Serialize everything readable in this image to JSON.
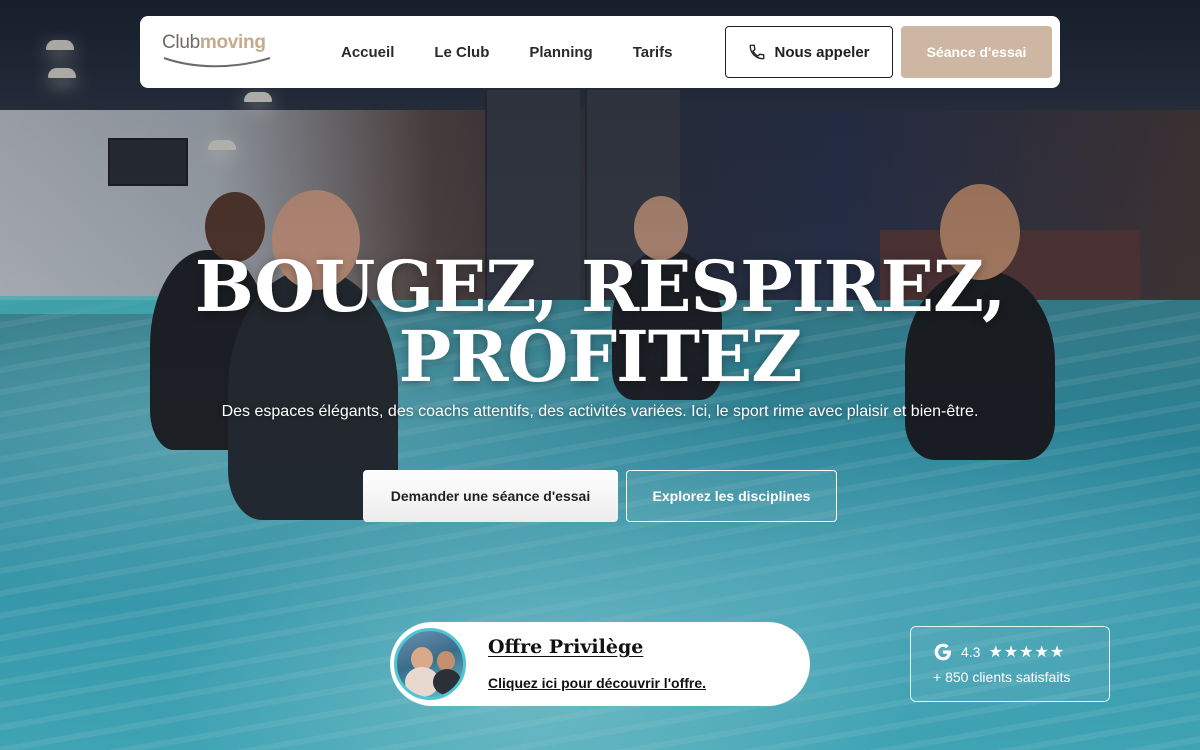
{
  "brand": {
    "logo_part1": "Club",
    "logo_part2": "moving",
    "accent_color": "#cdb7a2",
    "logo_accent_color": "#c5aa8c"
  },
  "nav": {
    "items": [
      {
        "label": "Accueil"
      },
      {
        "label": "Le Club"
      },
      {
        "label": "Planning"
      },
      {
        "label": "Tarifs"
      }
    ],
    "call_label": "Nous appeler",
    "call_icon": "phone-icon",
    "trial_label": "Séance d'essai"
  },
  "hero": {
    "title_line1": "BOUGEZ, RESPIREZ,",
    "title_line2": "PROFITEZ",
    "subtitle": "Des espaces élégants, des coachs attentifs, des activités variées. Ici, le sport rime avec plaisir et bien-être.",
    "primary_cta": "Demander une séance d'essai",
    "secondary_cta": "Explorez les disciplines"
  },
  "offer": {
    "title": "Offre Privilège",
    "link": "Cliquez ici pour découvrir l'offre.",
    "thumb_border_color": "#4fc6d3"
  },
  "rating": {
    "icon": "google-g-icon",
    "score": "4.3",
    "stars": "★★★★★",
    "stars_count": 5,
    "clients": "+ 850 clients satisfaits"
  }
}
